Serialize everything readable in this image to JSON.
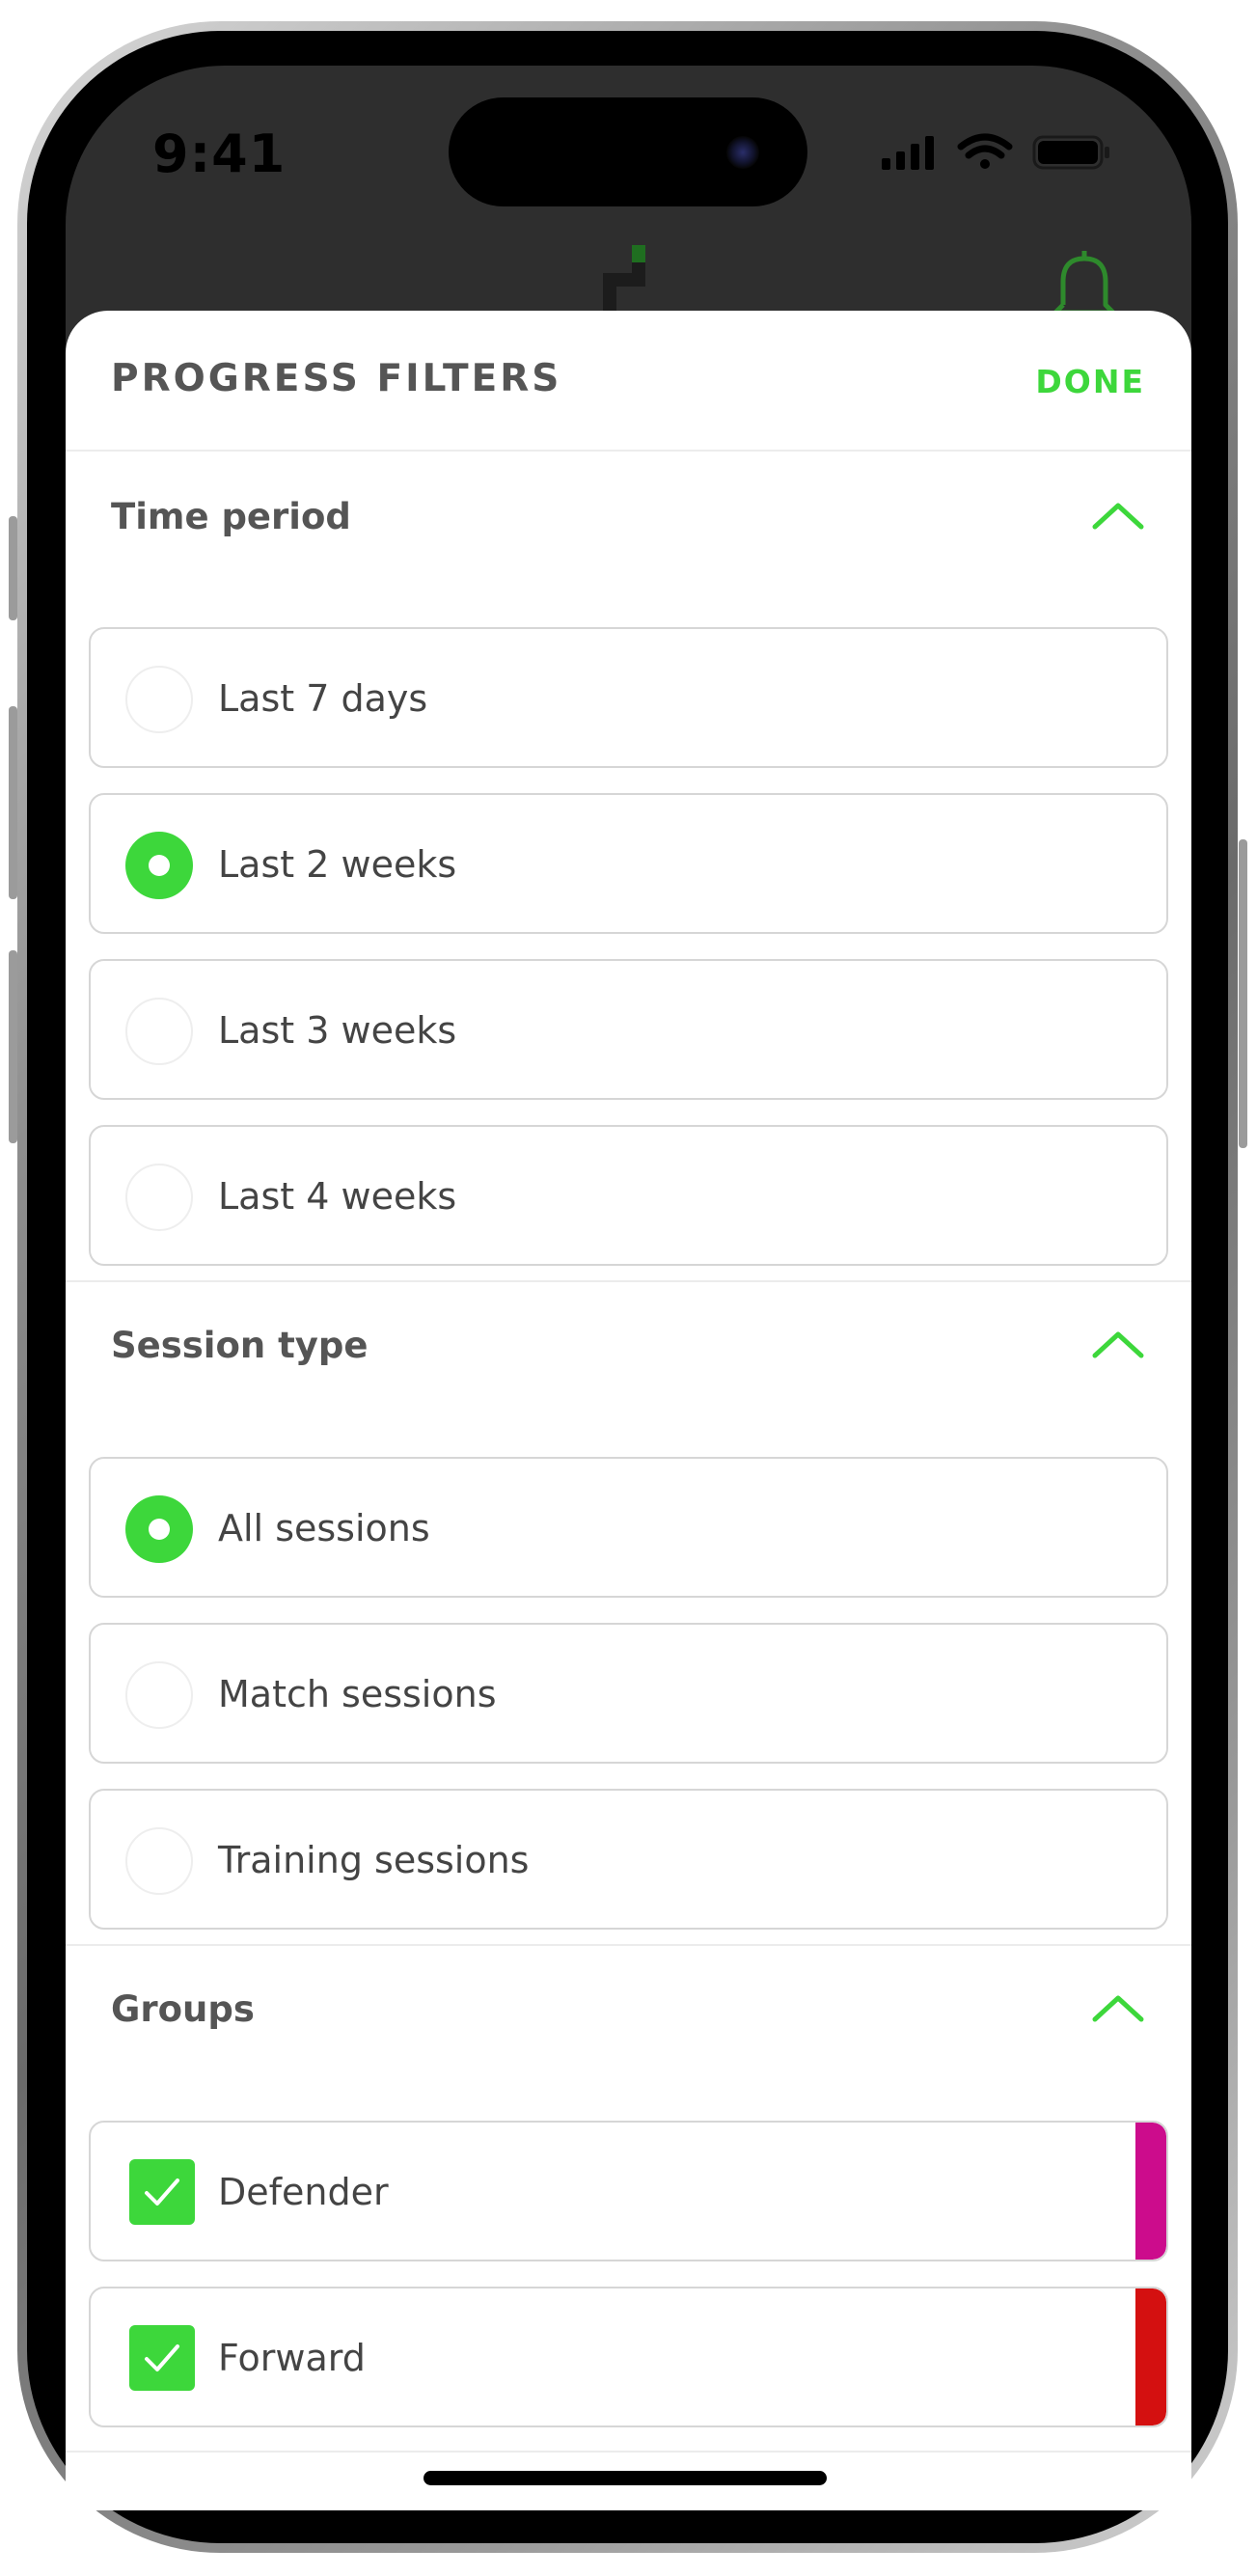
{
  "status_bar": {
    "time": "9:41"
  },
  "sheet": {
    "title": "PROGRESS FILTERS",
    "done_label": "DONE"
  },
  "sections": {
    "time_period": {
      "title": "Time period",
      "options": [
        {
          "label": "Last 7 days",
          "selected": false
        },
        {
          "label": "Last 2 weeks",
          "selected": true
        },
        {
          "label": "Last 3 weeks",
          "selected": false
        },
        {
          "label": "Last 4 weeks",
          "selected": false
        }
      ]
    },
    "session_type": {
      "title": "Session type",
      "options": [
        {
          "label": "All sessions",
          "selected": true
        },
        {
          "label": "Match sessions",
          "selected": false
        },
        {
          "label": "Training sessions",
          "selected": false
        }
      ]
    },
    "groups": {
      "title": "Groups",
      "options": [
        {
          "label": "Defender",
          "checked": true,
          "color": "#cc0c8c"
        },
        {
          "label": "Forward",
          "checked": true,
          "color": "#d41010"
        }
      ]
    }
  },
  "colors": {
    "accent": "#3dd73b",
    "text": "#555555"
  },
  "icons": {
    "header_logo": "app-logo-icon",
    "header_bell": "bell-icon",
    "section_toggle": "chevron-up-icon",
    "group_check": "checkmark-icon"
  }
}
